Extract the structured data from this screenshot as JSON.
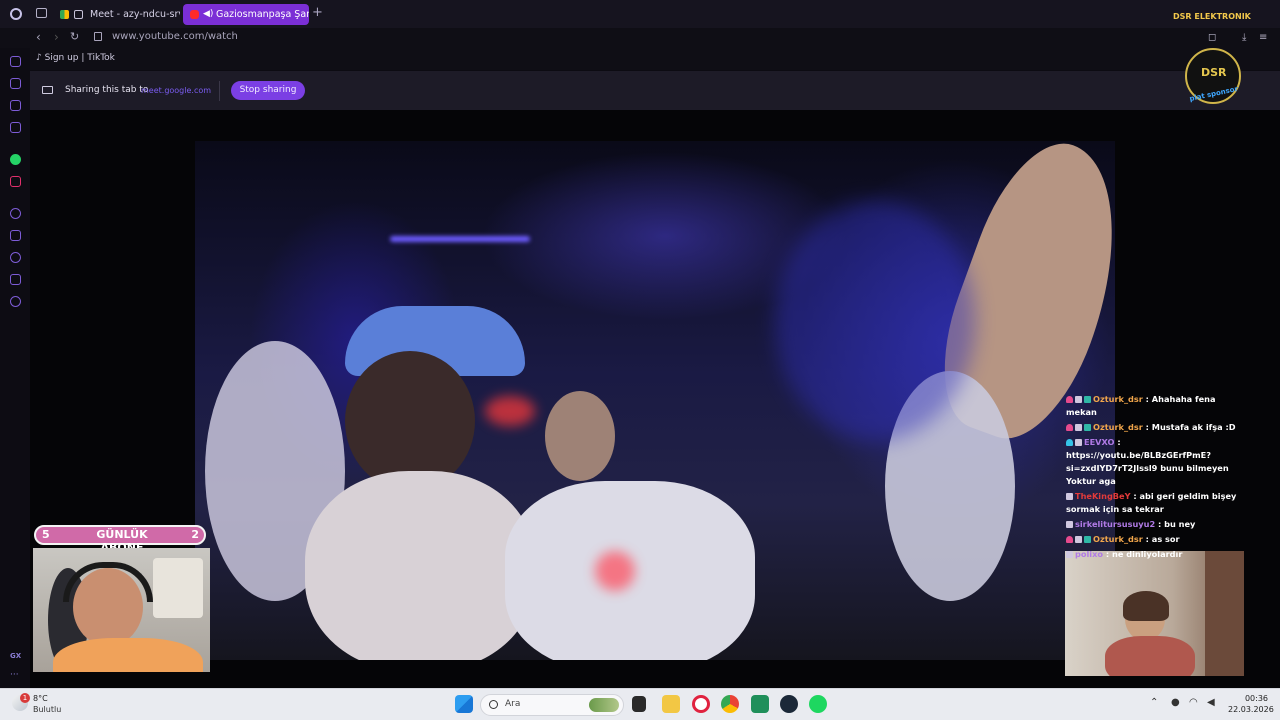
{
  "browser": {
    "tabs": [
      {
        "label": "Meet - azy-ndcu-srv"
      },
      {
        "label": "Gaziosmanpaşa Şanze"
      }
    ],
    "url": "www.youtube.com/watch",
    "bookmark": "Sign up | TikTok"
  },
  "share_bar": {
    "text": "Sharing this tab to",
    "target": "meet.google.com",
    "stop_label": "Stop sharing"
  },
  "overlay": {
    "abone_left": "5",
    "abone_title": "GÜNLÜK ABONE",
    "abone_right": "2",
    "logo_title": "DSR ELEKTRONIK",
    "logo_mark": "DSR",
    "logo_sub": "plat sponsor"
  },
  "chat": [
    {
      "user": "Ozturk_dsr",
      "text": " : Ahahaha fena mekan",
      "badges": [
        "pink",
        "gray",
        "teal"
      ],
      "color": "orange"
    },
    {
      "user": "Ozturk_dsr",
      "text": " : Mustafa ak ifşa :D",
      "badges": [
        "pink",
        "gray",
        "teal"
      ],
      "color": "orange"
    },
    {
      "user": "EEVXO",
      "text": " : https://youtu.be/BLBzGErfPmE?si=zxdIYD7rT2Jlssl9 bunu bilmeyen Yoktur aga",
      "badges": [
        "cyan",
        "gray"
      ],
      "color": "purple"
    },
    {
      "user": "TheKingBeY",
      "text": " : abi geri geldim bişey sormak için sa tekrar",
      "badges": [
        "gray"
      ],
      "color": "red"
    },
    {
      "user": "sirkelitursusuyu2",
      "text": " : bu ney",
      "badges": [
        "gray"
      ],
      "color": "purple"
    },
    {
      "user": "Ozturk_dsr",
      "text": " : as sor",
      "badges": [
        "pink",
        "gray",
        "teal"
      ],
      "color": "orange"
    },
    {
      "user": "polixo",
      "text": " : ne dinliyolardır",
      "badges": [
        "gray"
      ],
      "color": "purple"
    }
  ],
  "taskbar": {
    "weather_temp": "8°C",
    "weather_desc": "Bulutlu",
    "weather_badge": "1",
    "search_label": "Ara",
    "time": "00:36",
    "date": "22.03.2026"
  }
}
